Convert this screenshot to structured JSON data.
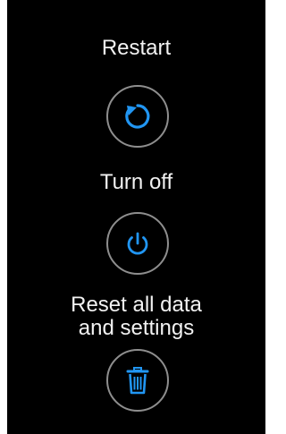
{
  "colors": {
    "background": "#000000",
    "text": "#f2f2f2",
    "ring": "#8e8e8e",
    "accent": "#2196f3"
  },
  "actions": [
    {
      "label": "Restart",
      "icon": "restart-icon"
    },
    {
      "label": "Turn off",
      "icon": "power-icon"
    },
    {
      "label": "Reset all data\nand settings",
      "icon": "trash-icon"
    }
  ]
}
